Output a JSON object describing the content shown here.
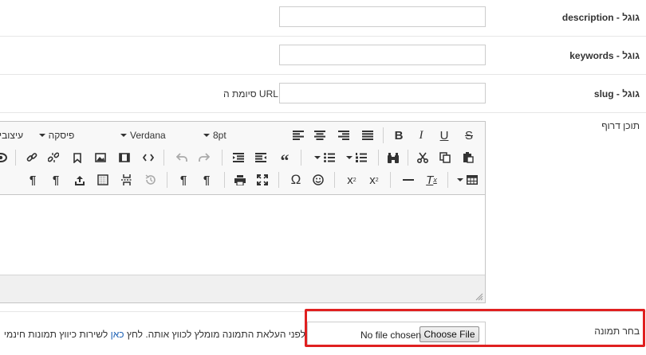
{
  "fields": {
    "description": {
      "label": "גוגל - description",
      "value": ""
    },
    "keywords": {
      "label": "גוגל - keywords",
      "value": ""
    },
    "slug": {
      "label": "גוגל - slug",
      "value": "",
      "suffix": "סיומת ה URL"
    },
    "content": {
      "label": "תוכן דרוף"
    },
    "image": {
      "label": "בחר תמונה"
    }
  },
  "editor": {
    "toolbar": {
      "styles_label": "עיצובי",
      "format_label": "פיסקה",
      "font_family": "Verdana",
      "font_size": "8pt"
    },
    "row1_icons": [
      "align-left-icon",
      "align-center-icon",
      "align-right-icon",
      "justify-icon",
      "bold-icon",
      "italic-icon",
      "underline-icon",
      "strikethrough-icon"
    ],
    "row2_icons": [
      "preview-icon",
      "link-icon",
      "unlink-icon",
      "bookmark-icon",
      "image-icon",
      "media-icon",
      "code-icon",
      "undo-icon",
      "redo-icon",
      "outdent-icon",
      "indent-icon",
      "blockquote-icon",
      "bullet-list-icon",
      "numbered-list-icon",
      "find-replace-icon",
      "cut-icon",
      "copy-icon",
      "paste-icon"
    ],
    "row3_icons": [
      "paragraph-icon",
      "pilcrow-icon",
      "upload-icon",
      "template-icon",
      "page-break-icon",
      "restore-icon",
      "ltr-icon",
      "rtl-icon",
      "print-icon",
      "fullscreen-icon",
      "special-char-icon",
      "emoticon-icon",
      "subscript-icon",
      "superscript-icon",
      "horizontal-rule-icon",
      "clear-format-icon",
      "table-icon"
    ]
  },
  "file_upload": {
    "status": "No file chosen",
    "button_label": "Choose File",
    "hint_prefix": "לפני העלאת התמונה מומלץ לכווץ אותה. לחץ",
    "hint_link": "כאן",
    "hint_suffix": "לשירות כיווץ תמונות חינמי"
  },
  "colors": {
    "highlight": "#e02020",
    "link": "#1a5fb4",
    "border": "#cccccc"
  }
}
